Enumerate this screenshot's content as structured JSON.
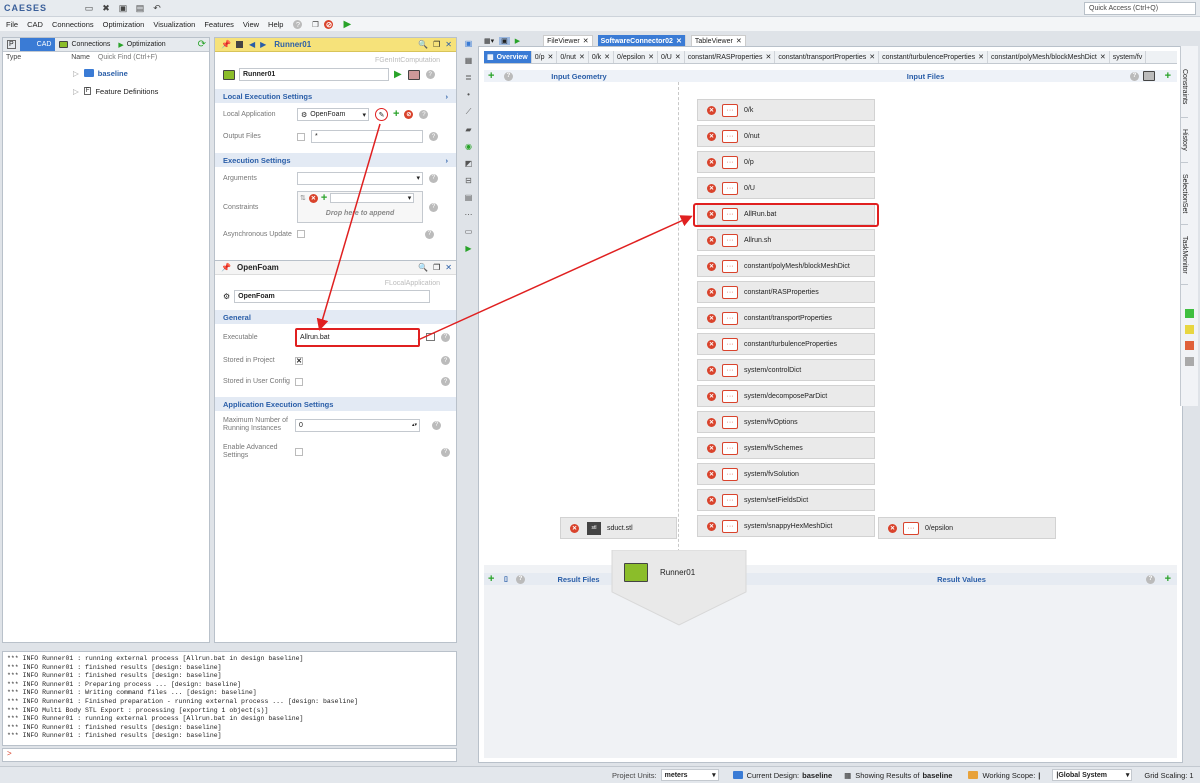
{
  "app": {
    "logo": "CAESES",
    "quick_access_placeholder": "Quick Access (Ctrl+Q)"
  },
  "menu": [
    "File",
    "CAD",
    "Connections",
    "Optimization",
    "Visualization",
    "Features",
    "View",
    "Help"
  ],
  "left": {
    "tabs": [
      "P",
      "CAD",
      "Connections",
      "Optimization"
    ],
    "columns": {
      "type": "Type",
      "name": "Name",
      "quick_find": "Quick Find (Ctrl+F)"
    },
    "tree": [
      {
        "label": "baseline",
        "bold": true
      },
      {
        "label": "Feature Definitions",
        "bold": false
      }
    ]
  },
  "runner": {
    "header_title": "Runner01",
    "type_label": "FGenIntComputation",
    "name": "Runner01",
    "local_exec": {
      "title": "Local Execution Settings",
      "app_label": "Local Application",
      "app_value": "OpenFoam",
      "output_label": "Output Files",
      "output_value": "*"
    },
    "exec": {
      "title": "Execution Settings",
      "args_label": "Arguments",
      "constraints_label": "Constraints",
      "drop_hint": "Drop here to append",
      "async_label": "Asynchronous Update"
    }
  },
  "openfoam": {
    "header_title": "OpenFoam",
    "type_label": "FLocalApplication",
    "name": "OpenFoam",
    "general": {
      "title": "General",
      "exe_label": "Executable",
      "exe_value": "Allrun.bat",
      "stored_project_label": "Stored in Project",
      "stored_project_checked": true,
      "stored_user_label": "Stored in User Config"
    },
    "app_exec": {
      "title": "Application Execution Settings",
      "max_label_1": "Maximum Number of",
      "max_label_2": "Running Instances",
      "max_value": "0",
      "adv_label_1": "Enable Advanced",
      "adv_label_2": "Settings"
    }
  },
  "view_tabs": [
    "FileViewer",
    "SoftwareConnector02",
    "TableViewer"
  ],
  "file_tabs": [
    "Overview",
    "0/p",
    "0/nut",
    "0/k",
    "0/epsilon",
    "0/U",
    "constant/RASProperties",
    "constant/transportProperties",
    "constant/turbulenceProperties",
    "constant/polyMesh/blockMeshDict",
    "system/fv"
  ],
  "connector": {
    "input_geometry": "Input Geometry",
    "input_files": "Input Files",
    "result_files": "Result Files",
    "result_values": "Result Values",
    "geometry_file": "sduct.stl",
    "geometry_badge": "stl",
    "runner": "Runner01",
    "files": [
      "0/k",
      "0/nut",
      "0/p",
      "0/U",
      "AllRun.bat",
      "Allrun.sh",
      "constant/polyMesh/blockMeshDict",
      "constant/RASProperties",
      "constant/transportProperties",
      "constant/turbulenceProperties",
      "system/controlDict",
      "system/decomposeParDict",
      "system/fvOptions",
      "system/fvSchemes",
      "system/fvSolution",
      "system/setFieldsDict",
      "system/snappyHexMeshDict"
    ],
    "extra_file": "0/epsilon",
    "highlighted_file": "AllRun.bat"
  },
  "right_side_tabs": [
    "Constraints",
    "History",
    "SelectionSet",
    "TaskMonitor"
  ],
  "console": [
    "*** INFO Runner01 : running external process [Allrun.bat in design baseline]",
    "*** INFO Runner01 : finished results [design: baseline]",
    "*** INFO Runner01 : finished results [design: baseline]",
    "*** INFO Runner01 : Preparing process ... [design: baseline]",
    "*** INFO Runner01 : Writing command files ... [design: baseline]",
    "*** INFO Runner01 : Finished preparation - running external process ... [design: baseline]",
    "*** INFO Multi Body STL Export : processing [exporting 1 object(s)]",
    "*** INFO Runner01 : running external process [Allrun.bat in design baseline]",
    "*** INFO Runner01 : finished results [design: baseline]",
    "*** INFO Runner01 : finished results [design: baseline]"
  ],
  "cmd_prompt": ">",
  "status": {
    "units_label": "Project Units:",
    "units_value": "meters",
    "design_label": "Current Design:",
    "design_value": "baseline",
    "results_label": "Showing Results of",
    "results_value": "baseline",
    "scope_label": "Working Scope:",
    "scope_value": "|",
    "system_value": "|Global System",
    "grid_label": "Grid Scaling: 1"
  },
  "colors": {
    "accent": "#3a7bd5",
    "highlight": "#e02020",
    "ok": "#29a329",
    "section": "#2a5ea8"
  }
}
